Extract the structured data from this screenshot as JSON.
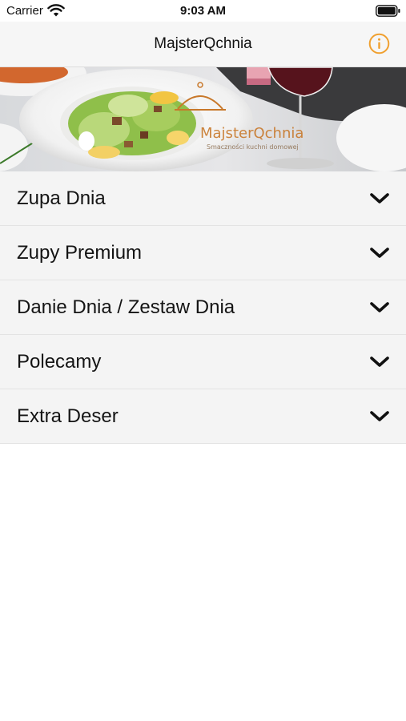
{
  "status_bar": {
    "carrier": "Carrier",
    "time": "9:03 AM"
  },
  "nav_bar": {
    "title": "MajsterQchnia",
    "info_icon": "info-circle-icon",
    "accent_color": "#f0a030"
  },
  "banner": {
    "logo_text": "MajsterQchnia",
    "logo_tagline": "Smaczności kuchni domowej",
    "logo_color": "#c8782a"
  },
  "menu": {
    "items": [
      {
        "label": "Zupa Dnia"
      },
      {
        "label": "Zupy Premium"
      },
      {
        "label": "Danie Dnia / Zestaw Dnia"
      },
      {
        "label": "Polecamy"
      },
      {
        "label": "Extra Deser"
      }
    ],
    "chevron_icon": "chevron-down-icon"
  }
}
